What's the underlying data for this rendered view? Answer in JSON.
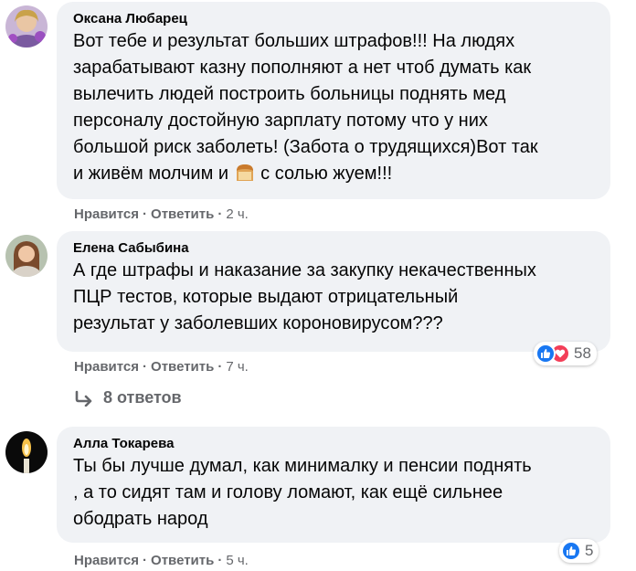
{
  "comments": [
    {
      "author": "Оксана Любарец",
      "text_lines": [
        "Вот тебе и результат больших штрафов!!! На людях",
        "зарабатывают казну пополняют а нет чтоб думать как",
        "вылечить людей построить больницы поднять мед",
        "персоналу достойную зарплату потому что у них",
        "большой риск заболеть! (Забота о трудящихся)Вот так"
      ],
      "last_line_before": "и живём молчим и ",
      "last_line_after": " с солью жуем!!!",
      "emoji": "bread-emoji",
      "like": "Нравится",
      "reply": "Ответить",
      "time": "2 ч."
    },
    {
      "author": "Елена Сабыбина",
      "text_lines": [
        "А где штрафы и наказание за закупку некачественных",
        "ПЦР тестов, которые выдают отрицательный",
        "результат у заболевших короновирусом???"
      ],
      "like": "Нравится",
      "reply": "Ответить",
      "time": "7 ч.",
      "reaction_count": "58",
      "reactions": [
        "like-icon",
        "love-icon"
      ]
    },
    {
      "author": "Алла Токарева",
      "text_lines": [
        "Ты бы лучше думал, как минималку и пенсии поднять",
        ", а то сидят там и голову ломают, как ещё сильнее",
        "ободрать народ"
      ],
      "like": "Нравится",
      "reply": "Ответить",
      "time": "5 ч.",
      "reaction_count": "5",
      "reactions": [
        "like-icon"
      ]
    }
  ],
  "replies_link": "8 ответов",
  "separator": "·",
  "colors": {
    "bubble": "#f0f2f5",
    "meta": "#65676b",
    "like": "#1877f2",
    "love": "#f33e58"
  }
}
